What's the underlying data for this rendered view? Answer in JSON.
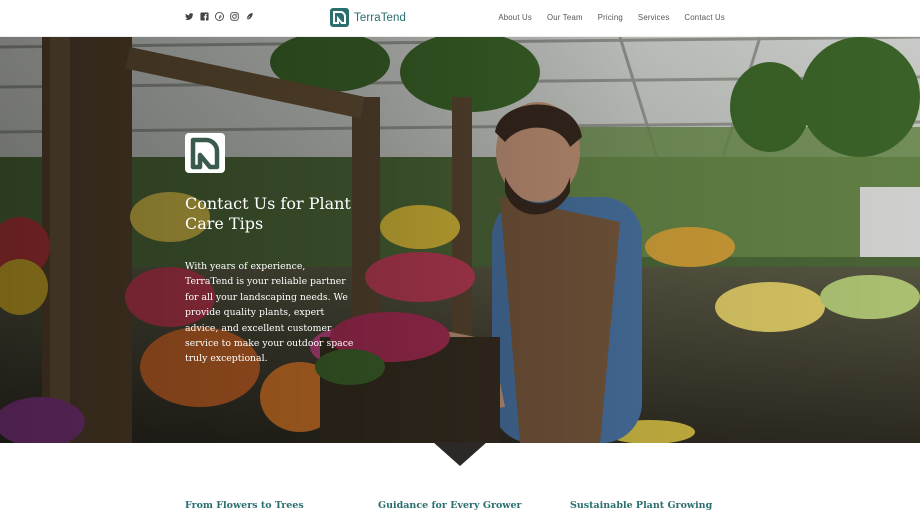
{
  "header": {
    "brand_name": "TerraTend",
    "social_icons": [
      "twitter-icon",
      "facebook-icon",
      "pinterest-icon",
      "instagram-icon",
      "leaf-icon"
    ],
    "nav": [
      {
        "label": "About Us"
      },
      {
        "label": "Our Team"
      },
      {
        "label": "Pricing"
      },
      {
        "label": "Services"
      },
      {
        "label": "Contact Us"
      }
    ]
  },
  "hero": {
    "title": "Contact Us for Plant Care Tips",
    "body": "With years of experience, TerraTend is your reliable partner for all your landscaping needs. We provide quality plants, expert advice, and excellent customer service to make your outdoor space truly exceptional."
  },
  "features": [
    {
      "label": "From Flowers to Trees"
    },
    {
      "label": "Guidance for Every Grower"
    },
    {
      "label": "Sustainable Plant Growing"
    }
  ],
  "colors": {
    "brand": "#2a6e6e",
    "nav_text": "#555555",
    "hero_text": "#ffffff"
  }
}
